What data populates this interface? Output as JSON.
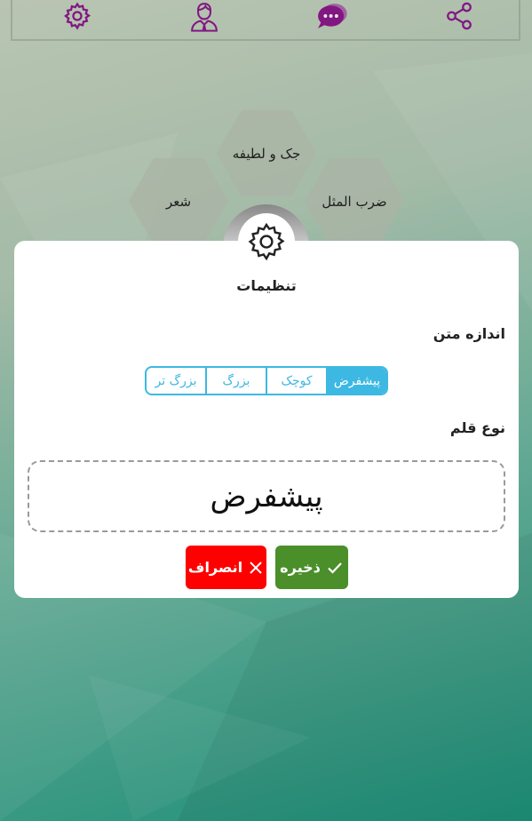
{
  "colors": {
    "accent_purple": "#8e1a8e",
    "segment_accent": "#3db8e3",
    "save_green": "#4a8f2a",
    "cancel_red": "#ff0000"
  },
  "toolbar": {
    "icons": [
      "gear-icon",
      "user-icon",
      "chat-icon",
      "share-icon"
    ]
  },
  "categories": {
    "joke": "جک و لطیفه",
    "poem": "شعر",
    "proverb": "ضرب المثل"
  },
  "dialog": {
    "title": "تنظیمات",
    "text_size_label": "اندازه متن",
    "text_size_options": [
      "پیشفرض",
      "کوچک",
      "بزرگ",
      "بزرگ تر"
    ],
    "text_size_selected": "پیشفرض",
    "font_label": "نوع قلم",
    "font_value": "پیشفرض",
    "save_label": "ذخیره",
    "cancel_label": "انصراف"
  }
}
